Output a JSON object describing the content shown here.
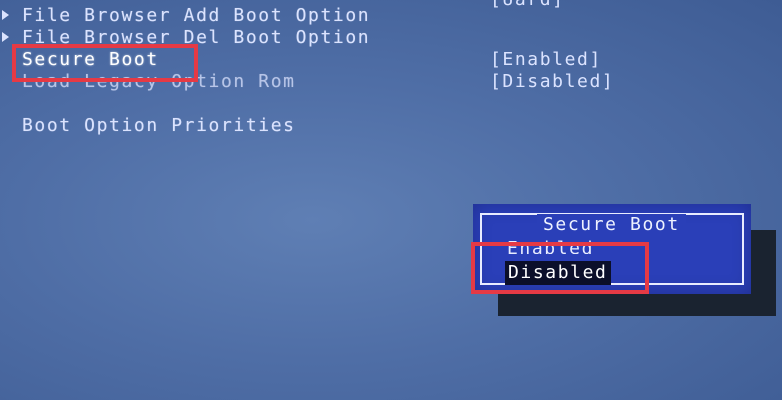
{
  "menu": {
    "items": [
      {
        "label": "File Browser Add Boot Option",
        "has_submenu": true
      },
      {
        "label": "File Browser Del Boot Option",
        "has_submenu": true
      },
      {
        "label": "Secure Boot",
        "value": "[Enabled]",
        "selected": true
      },
      {
        "label": "Load Legacy Option Rom",
        "value": "[Disabled]"
      },
      {
        "label": "Boot Option Priorities"
      }
    ],
    "partial_value_top": "[Uard]"
  },
  "popup": {
    "title": "Secure Boot",
    "options": [
      "Enabled",
      "Disabled"
    ],
    "selected": "Disabled"
  },
  "colors": {
    "background": "#4f6ea6",
    "popup_bg": "#2a3fb8",
    "highlight_box": "#e53a45",
    "selected_option_bg": "#0b0f2a"
  }
}
